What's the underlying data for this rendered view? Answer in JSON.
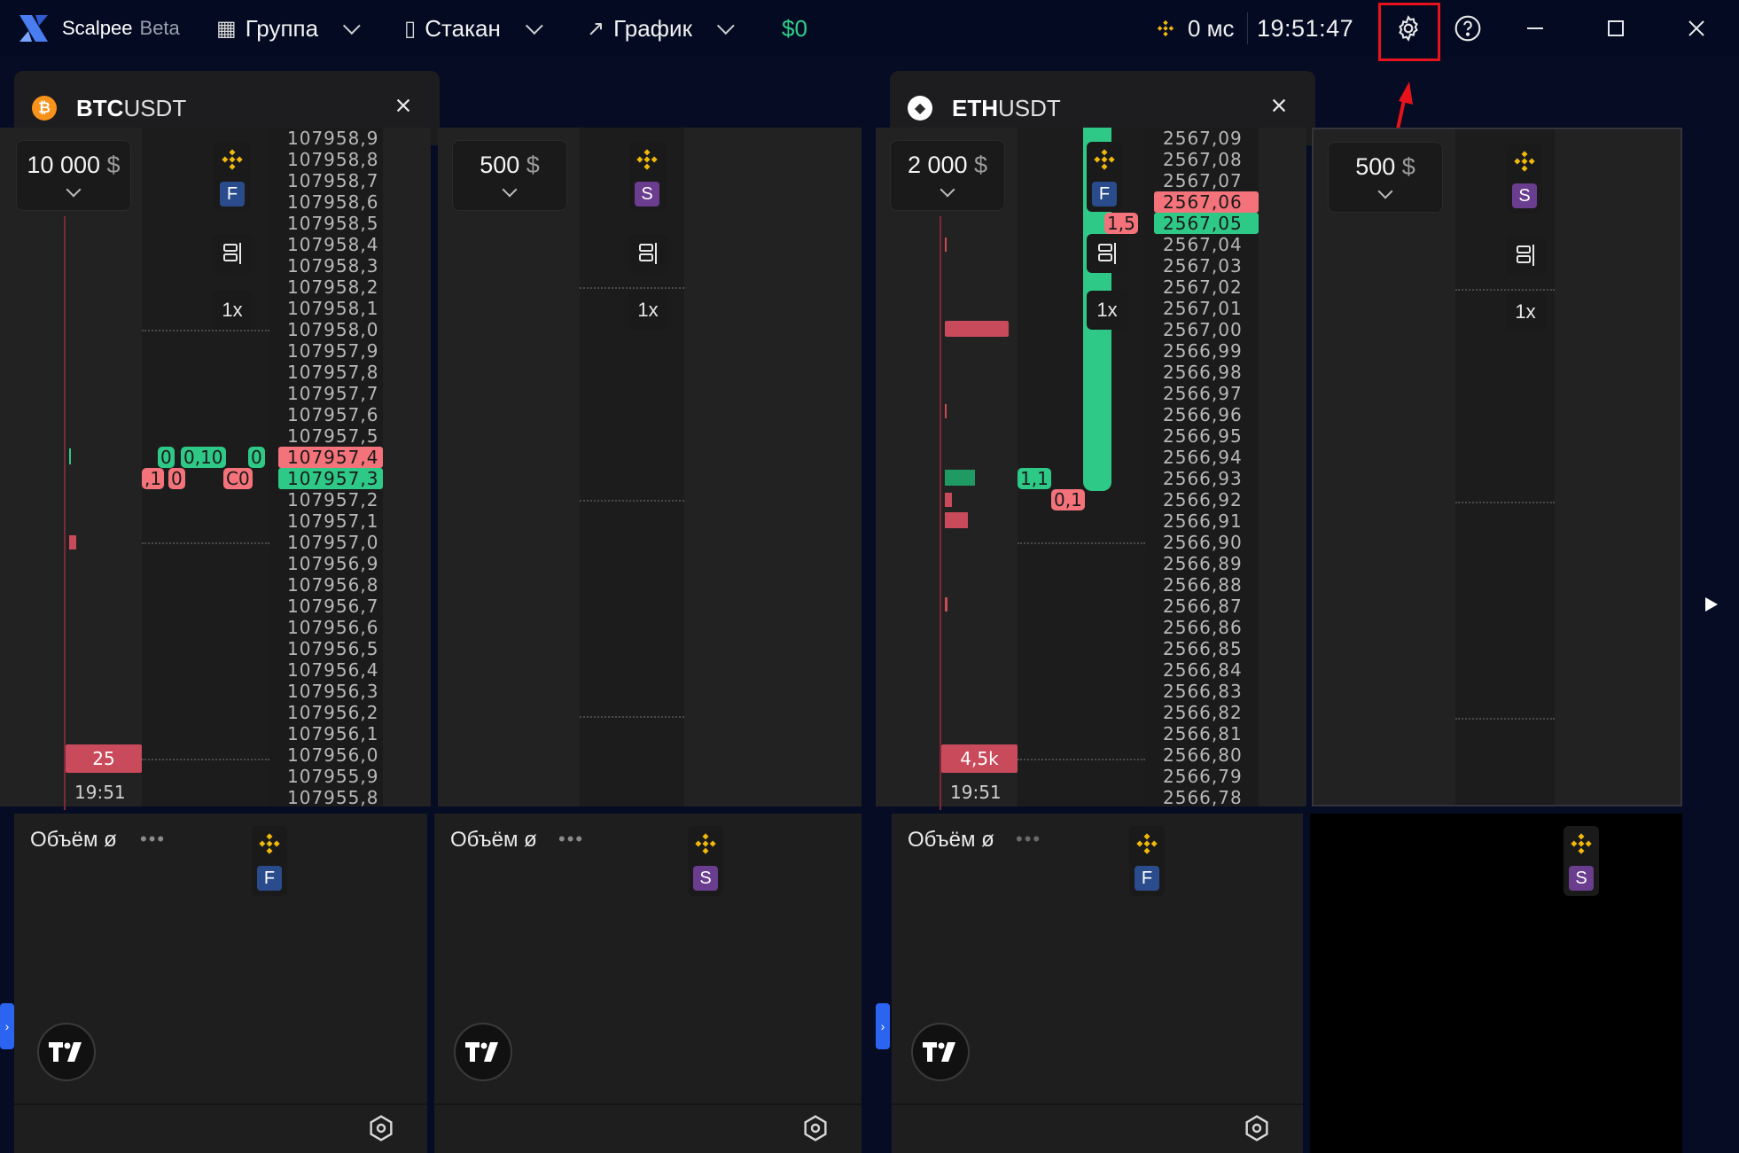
{
  "app": {
    "name": "Scalpee",
    "badge": "Beta"
  },
  "topbar": {
    "group_label": "Группа",
    "book_label": "Стакан",
    "chart_label": "График",
    "balance": "$0",
    "ping": "0 мс",
    "clock": "19:51:47"
  },
  "colors": {
    "accent_green": "#2fc987",
    "accent_red": "#f4727a",
    "highlight": "#e8131a"
  },
  "panels": [
    {
      "symbol_base": "BTC",
      "symbol_quote": "USDT",
      "coin_glyph": "₿",
      "amount": "10 000",
      "currency": "$",
      "market": "F",
      "leverage": "1x",
      "second_amount": "500",
      "second_market": "S",
      "second_leverage": "1x",
      "prices": [
        "107958,9",
        "107958,8",
        "107958,7",
        "107958,6",
        "107958,5",
        "107958,4",
        "107958,3",
        "107958,2",
        "107958,1",
        "107958,0",
        "107957,9",
        "107957,8",
        "107957,7",
        "107957,6",
        "107957,5",
        "107957,4",
        "107957,3",
        "107957,2",
        "107957,1",
        "107957,0",
        "107956,9",
        "107956,8",
        "107956,7",
        "107956,6",
        "107956,5",
        "107956,4",
        "107956,3",
        "107956,2",
        "107956,1",
        "107956,0",
        "107955,9",
        "107955,8"
      ],
      "ask_index": 15,
      "bid_index": 16,
      "tags_green": [
        "0",
        "0,10",
        "0"
      ],
      "tags_red": [
        ",1",
        "0",
        "C0"
      ],
      "volume_label": "25",
      "time_label": "19:51"
    },
    {
      "symbol_base": "ETH",
      "symbol_quote": "USDT",
      "coin_glyph": "◆",
      "amount": "2 000",
      "currency": "$",
      "market": "F",
      "leverage": "1x",
      "second_amount": "500",
      "second_market": "S",
      "second_leverage": "1x",
      "prices": [
        "2567,09",
        "2567,08",
        "2567,07",
        "2567,06",
        "2567,05",
        "2567,04",
        "2567,03",
        "2567,02",
        "2567,01",
        "2567,00",
        "2566,99",
        "2566,98",
        "2566,97",
        "2566,96",
        "2566,95",
        "2566,94",
        "2566,93",
        "2566,92",
        "2566,91",
        "2566,90",
        "2566,89",
        "2566,88",
        "2566,87",
        "2566,86",
        "2566,85",
        "2566,84",
        "2566,83",
        "2566,82",
        "2566,81",
        "2566,80",
        "2566,79",
        "2566,78"
      ],
      "ask_index": 3,
      "bid_index": 4,
      "tags_green": [
        "1,1"
      ],
      "tags_red": [
        "1,5",
        "0,1"
      ],
      "volume_label": "4,5k",
      "time_label": "19:51"
    }
  ],
  "volume_panels": [
    {
      "title": "Объём ø",
      "market": "F"
    },
    {
      "title": "Объём ø",
      "market": "S"
    },
    {
      "title": "Объём ø",
      "market": "F"
    },
    {
      "title": "",
      "market": "S"
    }
  ]
}
